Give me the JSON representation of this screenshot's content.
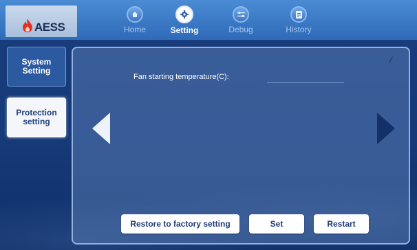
{
  "brand": {
    "name": "AESS"
  },
  "nav": {
    "items": [
      {
        "label": "Home",
        "icon": "home-icon"
      },
      {
        "label": "Setting",
        "icon": "gear-icon"
      },
      {
        "label": "Debug",
        "icon": "sliders-icon"
      },
      {
        "label": "History",
        "icon": "document-icon"
      }
    ],
    "active": "Setting"
  },
  "sidebar": {
    "items": [
      {
        "label": "System\nSetting",
        "active": false
      },
      {
        "label": "Protection\nsetting",
        "active": true
      }
    ]
  },
  "panel": {
    "marker": "/",
    "field": {
      "label": "Fan starting temperature(C):",
      "value": ""
    }
  },
  "actions": {
    "restore_label": "Restore to factory setting",
    "set_label": "Set",
    "restart_label": "Restart"
  },
  "colors": {
    "topbar": "#3a78c6",
    "panel_border": "#93b2e0",
    "active_tab": "#ffffff",
    "brand_flame": "#e5301f"
  }
}
